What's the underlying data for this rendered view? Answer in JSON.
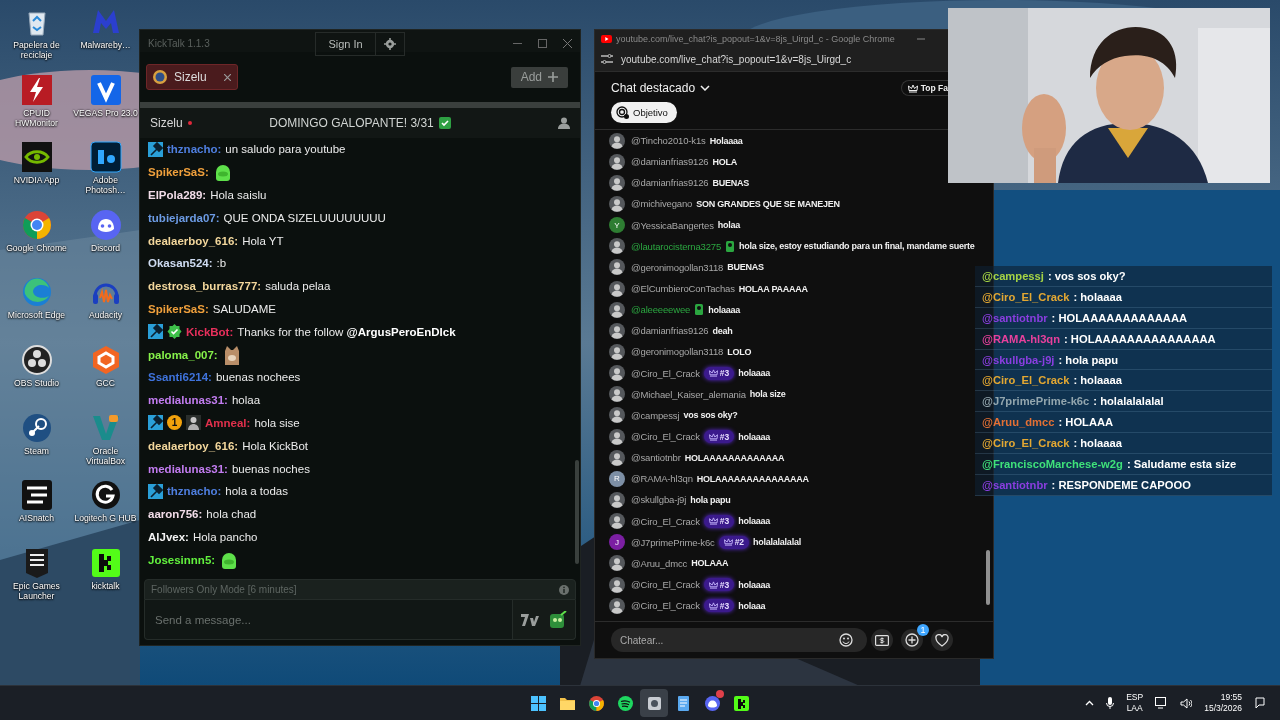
{
  "desktop_icons": [
    {
      "label": "Papelera de reciclaje",
      "kind": "recycle"
    },
    {
      "label": "Malwareby…",
      "kind": "malware"
    },
    {
      "label": "CPUID HWMonitor",
      "kind": "cpuid"
    },
    {
      "label": "VEGAS Pro 23.0",
      "kind": "vegas"
    },
    {
      "label": "NVIDIA App",
      "kind": "nvidia"
    },
    {
      "label": "Adobe Photosh…",
      "kind": "photoshop"
    },
    {
      "label": "Google Chrome",
      "kind": "chrome"
    },
    {
      "label": "Discord",
      "kind": "discord"
    },
    {
      "label": "Microsoft Edge",
      "kind": "edge"
    },
    {
      "label": "Audacity",
      "kind": "audacity"
    },
    {
      "label": "OBS Studio",
      "kind": "obs"
    },
    {
      "label": "GCC",
      "kind": "gcc"
    },
    {
      "label": "Steam",
      "kind": "steam"
    },
    {
      "label": "Oracle VirtualBox",
      "kind": "virtualbox"
    },
    {
      "label": "AISnatch",
      "kind": "aisnatch"
    },
    {
      "label": "Logitech G HUB",
      "kind": "logitech"
    },
    {
      "label": "Epic Games Launcher",
      "kind": "epic"
    },
    {
      "label": "kicktalk",
      "kind": "kick"
    }
  ],
  "kicktalk": {
    "title": "KickTalk 1.1.3",
    "sign_in": "Sign In",
    "tabs": [
      {
        "label": "Sizelu",
        "selected": true
      }
    ],
    "add_button": "Add",
    "channel": {
      "name": "Sizelu",
      "live": true,
      "stream_title": "DOMINGO GALOPANTE! 3/31"
    },
    "messages": [
      {
        "badges": [
          {
            "kind": "mod"
          }
        ],
        "user": "thznacho:",
        "color": "#4f7fe0",
        "text": "un saludo para youtube"
      },
      {
        "user": "SpikerSaS:",
        "color": "#f0a03c",
        "emote": {
          "kind": "blob"
        }
      },
      {
        "user": "ElPola289:",
        "color": "#f2dce8",
        "text": "Hola saislu"
      },
      {
        "user": "tubiejarda07:",
        "color": "#6c9be4",
        "text": "QUE ONDA SIZELUUUUUUUU"
      },
      {
        "user": "dealaerboy_616:",
        "color": "#f3d79c",
        "text": "Hola YT"
      },
      {
        "user": "Okasan524:",
        "color": "#cfdcf2",
        "text": ":b"
      },
      {
        "user": "destrosa_burras777:",
        "color": "#f3d79c",
        "text": "saluda pelaa"
      },
      {
        "user": "SpikerSaS:",
        "color": "#f0a03c",
        "text": "SALUDAME"
      },
      {
        "badges": [
          {
            "kind": "mod"
          },
          {
            "kind": "verified"
          }
        ],
        "user": "KickBot:",
        "color": "#e8305c",
        "text": "Thanks for the follow **@ArgusPeroEnDIck**"
      },
      {
        "user": "paloma_007:",
        "color": "#86f24a",
        "emote": {
          "kind": "cat"
        }
      },
      {
        "user": "Ssanti6214:",
        "color": "#3f73dc",
        "text": "buenas nochees"
      },
      {
        "user": "medialunas31:",
        "color": "#c27cf0",
        "text": "holaa"
      },
      {
        "badges": [
          {
            "kind": "mod"
          },
          {
            "kind": "sub",
            "label": "1"
          },
          {
            "kind": "avatar"
          }
        ],
        "user": "Amneal:",
        "color": "#e0304c",
        "text": "hola sise"
      },
      {
        "user": "dealaerboy_616:",
        "color": "#f3d79c",
        "text": "Hola KickBot"
      },
      {
        "user": "medialunas31:",
        "color": "#c27cf0",
        "text": "buenas noches"
      },
      {
        "badges": [
          {
            "kind": "mod"
          }
        ],
        "user": "thznacho:",
        "color": "#4f7fe0",
        "text": "hola a todas"
      },
      {
        "user": "aaron756:",
        "color": "#f2dce8",
        "text": "hola chad"
      },
      {
        "user": "AlJvex:",
        "color": "#f4f4f4",
        "text": "Hola pancho"
      },
      {
        "user": "Josesinnn5:",
        "color": "#62f03e",
        "emote": {
          "kind": "blob"
        }
      }
    ],
    "followers_notice": "Followers Only Mode [6 minutes]",
    "input": {
      "placeholder": "Send a message..."
    }
  },
  "youtube_chat": {
    "window_title": "youtube.com/live_chat?is_popout=1&v=8js_Uirgd_c - Google Chrome",
    "address": "youtube.com/live_chat?is_popout=1&v=8js_Uirgd_c",
    "header": "Chat destacado",
    "top_button": "Top Fa",
    "chip": "Objetivo",
    "messages": [
      {
        "author": "@Tincho2010-k1s",
        "member": false,
        "text": "Holaaaa"
      },
      {
        "author": "@damianfrias9126",
        "member": false,
        "text": "HOLA"
      },
      {
        "author": "@damianfrias9126",
        "member": false,
        "text": "BUENAS"
      },
      {
        "author": "@michivegano",
        "member": false,
        "text": "SON GRANDES QUE SE MANEJEN"
      },
      {
        "avatar": {
          "kind": "letter",
          "letter": "Y",
          "color": "#2e7d32"
        },
        "author": "@YessicaBangertes",
        "member": false,
        "text": "holaa"
      },
      {
        "author": "@lautarocisterna3275",
        "member": true,
        "text": "hola size, estoy estudiando para un final, mandame suerte"
      },
      {
        "author": "@geronimogollan3118",
        "member": false,
        "text": "BUENAS"
      },
      {
        "author": "@ElCumbieroConTachas",
        "member": false,
        "text": "HOLAA PAAAAA"
      },
      {
        "author": "@aleeeeewee",
        "member": true,
        "text": "holaaaa"
      },
      {
        "author": "@damianfrias9126",
        "member": false,
        "text": "deah"
      },
      {
        "author": "@geronimogollan3118",
        "member": false,
        "text": "LOLO"
      },
      {
        "author": "@Ciro_El_Crack",
        "member": false,
        "rank": "#3",
        "text": "holaaaa"
      },
      {
        "author": "@Michael_Kaiser_alemania",
        "member": false,
        "text": "hola size"
      },
      {
        "author": "@campessj",
        "member": false,
        "text": "vos sos oky?"
      },
      {
        "author": "@Ciro_El_Crack",
        "member": false,
        "rank": "#3",
        "text": "holaaaa"
      },
      {
        "author": "@santiotnbr",
        "member": false,
        "text": "HOLAAAAAAAAAAAAA"
      },
      {
        "avatar": {
          "kind": "letter",
          "letter": "R",
          "color": "#7d8fa5"
        },
        "author": "@RAMA-hl3qn",
        "member": false,
        "text": "HOLAAAAAAAAAAAAAAA"
      },
      {
        "author": "@skullgba-j9j",
        "member": false,
        "text": "hola papu"
      },
      {
        "author": "@Ciro_El_Crack",
        "member": false,
        "rank": "#3",
        "text": "holaaaa"
      },
      {
        "avatar": {
          "kind": "letter",
          "letter": "J",
          "color": "#7b1fa2"
        },
        "author": "@J7primePrime-k6c",
        "member": false,
        "rank": "#2",
        "text": "holalalalalal"
      },
      {
        "author": "@Aruu_dmcc",
        "member": false,
        "text": "HOLAAA"
      },
      {
        "author": "@Ciro_El_Crack",
        "member": false,
        "rank": "#3",
        "text": "holaaaa"
      },
      {
        "author": "@Ciro_El_Crack",
        "member": false,
        "rank": "#3",
        "text": "holaaa"
      }
    ],
    "input": {
      "placeholder": "Chatear..."
    },
    "gift_count": "1"
  },
  "overlay_chat": [
    {
      "author": "@campessj",
      "color": "#a6d445",
      "text": ": vos sos oky?"
    },
    {
      "author": "@Ciro_El_Crack",
      "color": "#e4a832",
      "text": ": holaaaa"
    },
    {
      "author": "@santiotnbr",
      "color": "#8a3ee0",
      "text": ": HOLAAAAAAAAAAAAA"
    },
    {
      "author": "@RAMA-hl3qn",
      "color": "#e8409c",
      "text": ": HOLAAAAAAAAAAAAAAA"
    },
    {
      "author": "@skullgba-j9j",
      "color": "#8a3ee0",
      "text": ": hola papu"
    },
    {
      "author": "@Ciro_El_Crack",
      "color": "#e4a832",
      "text": ": holaaaa"
    },
    {
      "author": "@J7primePrime-k6c",
      "color": "#93a6ae",
      "text": ": holalalalalal"
    },
    {
      "author": "@Aruu_dmcc",
      "color": "#e47034",
      "text": ": HOLAAA"
    },
    {
      "author": "@Ciro_El_Crack",
      "color": "#e4a832",
      "text": ": holaaaa"
    },
    {
      "author": "@FranciscoMarchese-w2g",
      "color": "#3fe27a",
      "text": ": Saludame esta size"
    },
    {
      "author": "@santiotnbr",
      "color": "#8a3ee0",
      "text": ": RESPONDEME CAPOOO"
    }
  ],
  "taskbar": {
    "apps": [
      {
        "kind": "start",
        "selected": false
      },
      {
        "kind": "folder",
        "selected": false
      },
      {
        "kind": "chrome",
        "selected": false
      },
      {
        "kind": "spotify",
        "selected": false
      },
      {
        "kind": "tool",
        "selected": true
      },
      {
        "kind": "notes",
        "selected": false
      },
      {
        "kind": "discord",
        "selected": false
      },
      {
        "kind": "kick",
        "selected": false
      }
    ],
    "tray": {
      "language": "ESP",
      "layout": "LAA",
      "time": "19:55",
      "date": "15/3/2026"
    }
  }
}
